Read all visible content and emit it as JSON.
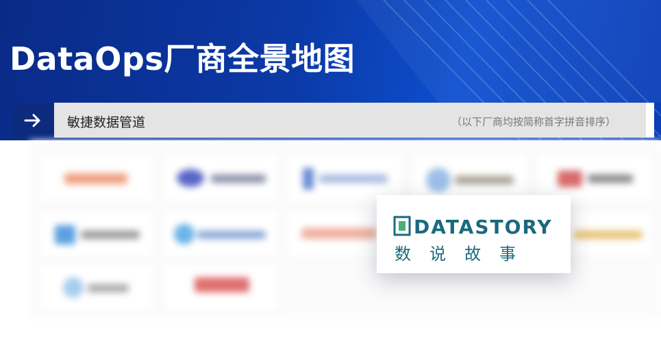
{
  "header": {
    "title": "DataOps厂商全景地图"
  },
  "section": {
    "title": "敏捷数据管道",
    "note": "（以下厂商均按简称首字拼音排序）",
    "arrow_icon": "arrow-right-icon"
  },
  "featured_vendor": {
    "logo_text_en": "DATASTORY",
    "logo_text_cn": "数说故事",
    "brand_color": "#1a6a7c"
  },
  "colors": {
    "banner_dark": "#0a2a86",
    "banner_light": "#0e4fd0",
    "arrow_box": "#0d2b7e",
    "bar_bg": "#e4e4e4"
  }
}
